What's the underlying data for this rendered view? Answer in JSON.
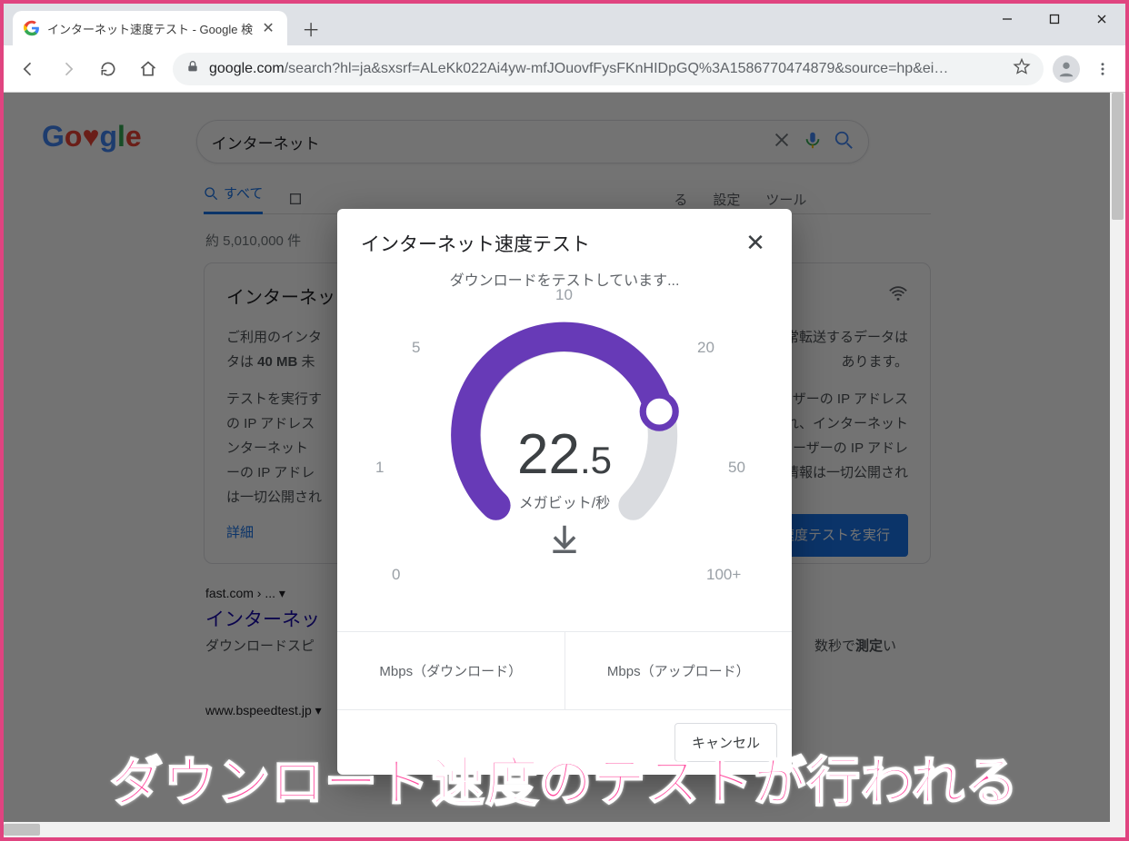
{
  "browser": {
    "tab_title": "インターネット速度テスト - Google 検",
    "url_host": "google.com",
    "url_path": "/search?hl=ja&sxsrf=ALeKk022Ai4yw-mfJOuovfFysFKnHIDpGQ%3A1586770474879&source=hp&ei…"
  },
  "page": {
    "logo_chars": [
      "G",
      "o",
      "o",
      "g",
      "l",
      "e"
    ],
    "search_query": "インターネット",
    "tabs": {
      "all": "すべて"
    },
    "right_links": {
      "ru": "る",
      "settings": "設定",
      "tools": "ツール"
    },
    "result_count": "約 5,010,000 件",
    "card": {
      "title": "インターネッ",
      "para1_a": "ご利用のインタ",
      "para1_b": "で通常転送するデータは ",
      "mb": "40 MB",
      "para1_c": " 未",
      "para1_d": "あります。",
      "para2_a": "テストを実行す",
      "para2_b": "す。また、ユーザーの IP アドレス",
      "para2_c": "ストが実行され、インターネット",
      "para2_d": "れる情報にはユーザーの IP アドレ",
      "para2_e": "するそれ以外の情報は一切公開され",
      "more": "詳細",
      "run_button": "速度テストを実行"
    },
    "result1": {
      "crumb": "fast.com › ... ▾",
      "title": "インターネッ",
      "desc_a": "ダウンロードスピ",
      "desc_b": "数秒で測定い"
    },
    "result2": {
      "crumb": "www.bspeedtest.jp ▾"
    }
  },
  "modal": {
    "title": "インターネット速度テスト",
    "ticks": {
      "t0": "0",
      "t1": "1",
      "t5": "5",
      "t10": "10",
      "t20": "20",
      "t50": "50",
      "t100": "100+"
    },
    "value_int": "22",
    "value_dec": ".5",
    "unit": "メガビット/秒",
    "status": "ダウンロードをテストしています...",
    "download_label": "Mbps（ダウンロード）",
    "upload_label": "Mbps（アップロード）",
    "cancel": "キャンセル"
  },
  "chart_data": {
    "type": "gauge",
    "title": "インターネット速度テスト",
    "unit": "Mbps (メガビット/秒)",
    "value": 22.5,
    "ticks": [
      0,
      1,
      5,
      10,
      20,
      50,
      100
    ],
    "tick_angles_deg": [
      225,
      195,
      165,
      90,
      15,
      -15,
      -45
    ],
    "range": [
      0,
      100
    ],
    "fill_color": "#673ab7",
    "track_color": "#dadce0"
  },
  "annotation": "ダウンロード速度のテストが行われる"
}
